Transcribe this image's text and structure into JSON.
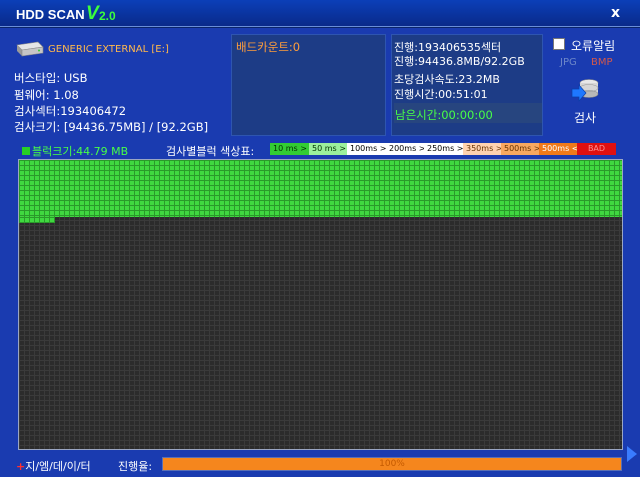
{
  "title": {
    "app": "HDD SCAN",
    "v": "V",
    "ver": "2.0"
  },
  "close_label": "x",
  "drive_name": "GENERIC EXTERNAL [E:]",
  "info": {
    "bus": "버스타입: USB",
    "firmware": "펌웨어: 1.08",
    "sectors": "검사섹터:193406472",
    "size": "검사크기: [94436.75MB] / [92.2GB]"
  },
  "bad_count": "배드카운트:0",
  "stats": {
    "progress_sector": "진행:193406535섹터",
    "progress_size": "진행:94436.8MB/92.2GB",
    "speed": "초당검사속도:23.2MB",
    "elapsed": "진행시간:00:51:01",
    "remaining": "남은시간:00:00:00"
  },
  "error_alert_label": "오류알림",
  "error_alert_checked": false,
  "jpg_label": "JPG",
  "bmp_label": "BMP",
  "scan_label": "검사",
  "block_size": "블럭크기:44.79 MB",
  "legend_label": "검사별블럭 색상표:",
  "legend": [
    {
      "label": "10 ms >",
      "bg": "#33cc33",
      "fg": "#003300"
    },
    {
      "label": "50 ms >",
      "bg": "#9cf09c",
      "fg": "#003300"
    },
    {
      "label": "100ms >",
      "bg": "#ffffff",
      "fg": "#000000"
    },
    {
      "label": "200ms >",
      "bg": "#ffffff",
      "fg": "#000000"
    },
    {
      "label": "250ms >",
      "bg": "#ffffff",
      "fg": "#000000"
    },
    {
      "label": "350ms >",
      "bg": "#ffd3b0",
      "fg": "#663300"
    },
    {
      "label": "500ms >",
      "bg": "#f8a860",
      "fg": "#663300"
    },
    {
      "label": "500ms <",
      "bg": "#f07a1a",
      "fg": "#ffffff"
    },
    {
      "label": "BAD",
      "bg": "#e01010",
      "fg": "#ff9090"
    }
  ],
  "brand": {
    "plus": "+",
    "text": "지/엠/데/이/터"
  },
  "progress_label": "진행율:",
  "progress_value": "100%",
  "progress_fraction": 1.0,
  "colors": {
    "accent_green": "#47ff47",
    "progress": "#f5861d",
    "bad": "#e01010"
  }
}
